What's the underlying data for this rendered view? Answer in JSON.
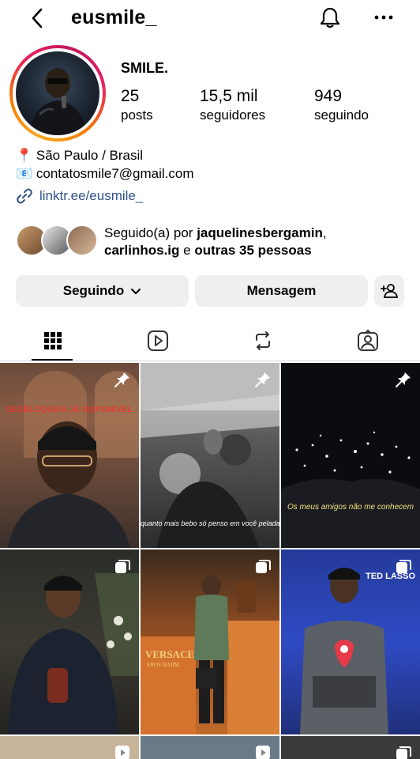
{
  "header": {
    "username": "eusmile_",
    "back_icon": "chevron-left-icon",
    "bell_icon": "bell-icon",
    "more_icon": "more-horizontal-icon"
  },
  "profile": {
    "display_name": "SMILE.",
    "stats": [
      {
        "value": "25",
        "label": "posts"
      },
      {
        "value": "15,5 mil",
        "label": "seguidores"
      },
      {
        "value": "949",
        "label": "seguindo"
      }
    ],
    "bio": {
      "location": "📍 São Paulo / Brasil",
      "email": "📧 contatosmile7@gmail.com",
      "link": "linktr.ee/eusmile_"
    },
    "followed_by": {
      "prefix": "Seguido(a) por ",
      "user1": "jaquelinesbergamin",
      "sep1": ",",
      "user2": "carlinhos.ig",
      "sep2": " e ",
      "others": "outras 35 pessoas"
    }
  },
  "actions": {
    "following_label": "Seguindo",
    "message_label": "Mensagem",
    "add_user_icon": "person-add-icon"
  },
  "tabs": [
    {
      "name": "grid",
      "icon": "grid-icon",
      "active": true
    },
    {
      "name": "reels",
      "icon": "reels-icon",
      "active": false
    },
    {
      "name": "reposts",
      "icon": "repost-icon",
      "active": false
    },
    {
      "name": "tagged",
      "icon": "tagged-icon",
      "active": false
    }
  ],
  "posts": {
    "p1": {
      "caption": "DESBLOQUEIA JÁ DISPONÍVEL",
      "badge": "pin-icon"
    },
    "p2": {
      "caption": "quanto mais bebo só penso em  você pelada",
      "badge": "pin-icon"
    },
    "p3": {
      "caption": "Os meus amigos não me conhecem",
      "badge": "pin-icon"
    },
    "p4": {
      "badge": "carousel-icon"
    },
    "p5": {
      "brand": "VERSACE",
      "sub": "EROS NAJIM",
      "badge": "carousel-icon"
    },
    "p6": {
      "brand": "TED LASSO",
      "badge": "carousel-icon"
    }
  },
  "colors": {
    "link": "#32518a",
    "button_bg": "#efefef",
    "caption_red": "#e53935"
  }
}
